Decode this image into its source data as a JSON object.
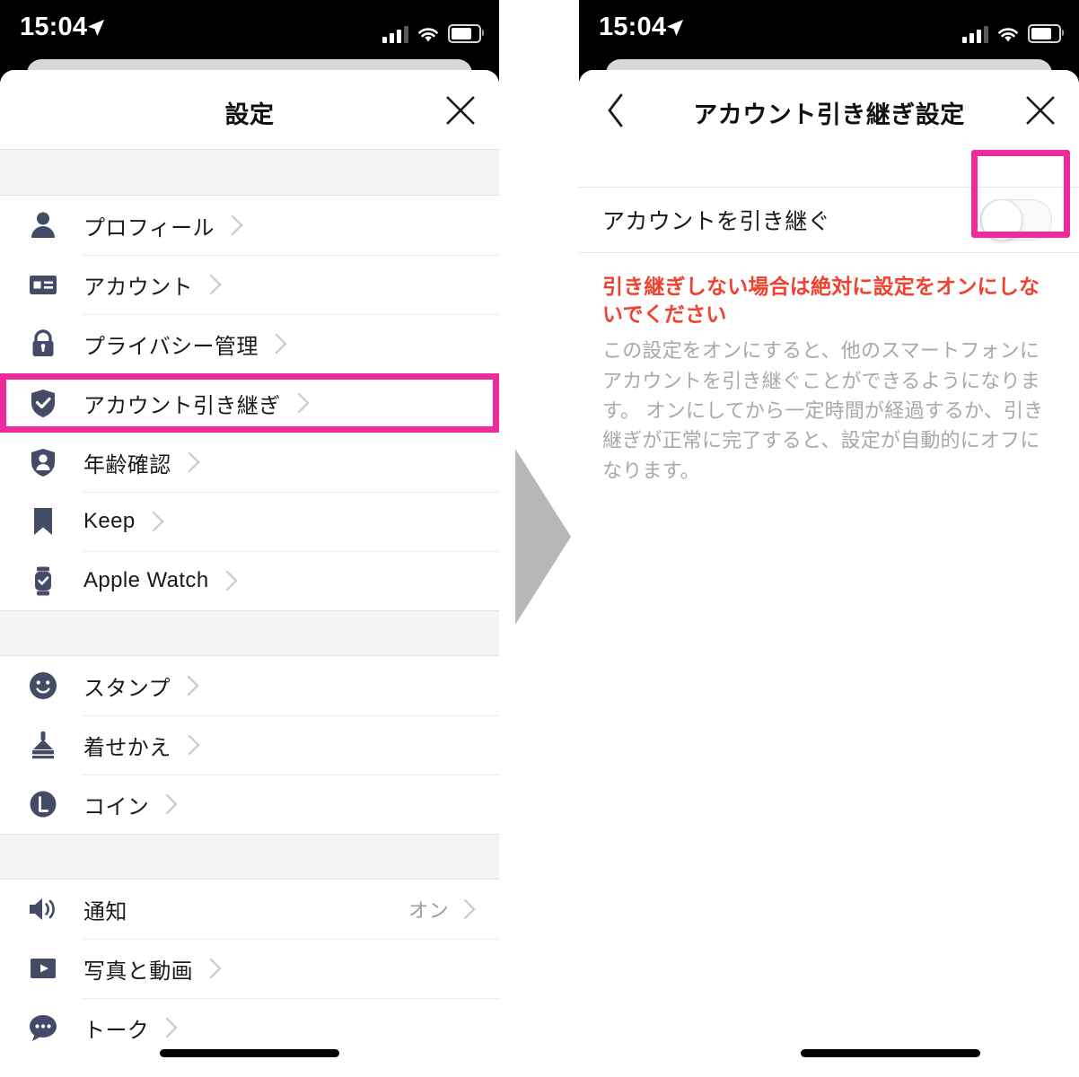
{
  "status_bar": {
    "time": "15:04",
    "location_icon": "location-arrow-icon",
    "signal_icon": "cellular-signal-icon",
    "wifi_icon": "wifi-icon",
    "battery_icon": "battery-icon"
  },
  "left_screen": {
    "header": {
      "title": "設定",
      "close_icon": "close-icon"
    },
    "groups": [
      {
        "items": [
          {
            "icon": "person-icon",
            "label": "プロフィール",
            "value": "",
            "chevron": "chevron-right-icon",
            "highlighted": false
          },
          {
            "icon": "id-card-icon",
            "label": "アカウント",
            "value": "",
            "chevron": "chevron-right-icon",
            "highlighted": false
          },
          {
            "icon": "lock-icon",
            "label": "プライバシー管理",
            "value": "",
            "chevron": "chevron-right-icon",
            "highlighted": false
          },
          {
            "icon": "shield-check-icon",
            "label": "アカウント引き継ぎ",
            "value": "",
            "chevron": "chevron-right-icon",
            "highlighted": true
          },
          {
            "icon": "shield-person-icon",
            "label": "年齢確認",
            "value": "",
            "chevron": "chevron-right-icon",
            "highlighted": false
          },
          {
            "icon": "bookmark-icon",
            "label": "Keep",
            "value": "",
            "chevron": "chevron-right-icon",
            "highlighted": false
          },
          {
            "icon": "apple-watch-icon",
            "label": "Apple Watch",
            "value": "",
            "chevron": "chevron-right-icon",
            "highlighted": false
          }
        ]
      },
      {
        "items": [
          {
            "icon": "smiley-icon",
            "label": "スタンプ",
            "value": "",
            "chevron": "chevron-right-icon",
            "highlighted": false
          },
          {
            "icon": "paintbrush-icon",
            "label": "着せかえ",
            "value": "",
            "chevron": "chevron-right-icon",
            "highlighted": false
          },
          {
            "icon": "coin-icon",
            "label": "コイン",
            "value": "",
            "chevron": "chevron-right-icon",
            "highlighted": false
          }
        ]
      },
      {
        "items": [
          {
            "icon": "speaker-icon",
            "label": "通知",
            "value": "オン",
            "chevron": "chevron-right-icon",
            "highlighted": false
          },
          {
            "icon": "play-square-icon",
            "label": "写真と動画",
            "value": "",
            "chevron": "chevron-right-icon",
            "highlighted": false
          },
          {
            "icon": "chat-bubble-icon",
            "label": "トーク",
            "value": "",
            "chevron": "chevron-right-icon",
            "highlighted": false
          }
        ]
      }
    ]
  },
  "right_screen": {
    "header": {
      "title": "アカウント引き継ぎ設定",
      "back_icon": "chevron-left-icon",
      "close_icon": "close-icon"
    },
    "toggle_row": {
      "label": "アカウントを引き継ぐ",
      "state": "off"
    },
    "description": {
      "warning": "引き継ぎしない場合は絶対に設定をオンにしないでください",
      "body": "この設定をオンにすると、他のスマートフォンにアカウントを引き継ぐことができるようになります。\nオンにしてから一定時間が経過するか、引き継ぎが正常に完了すると、設定が自動的にオフになります。"
    }
  },
  "transition_arrow_icon": "arrow-right-icon",
  "colors": {
    "highlight": "#ee2a9c",
    "icon": "#444b66",
    "warning_text": "#f0422e",
    "muted_text": "#a8a8ad",
    "gap_background": "#f4f4f5"
  }
}
